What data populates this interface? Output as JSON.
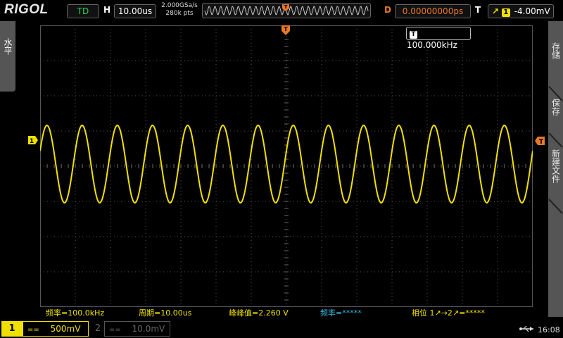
{
  "topbar": {
    "brand": "RIGOL",
    "run_state": "TD",
    "horizontal_label": "H",
    "timebase": "10.00us",
    "sample_rate": "2.000GSa/s",
    "memory_depth": "280k pts",
    "delay_label": "D",
    "delay_value": "0.00000000ps",
    "trigger_label": "T",
    "trigger_channel": "1",
    "trigger_level": "-4.00mV"
  },
  "left_panel": {
    "label": "水平"
  },
  "right_menu": {
    "item_1": "存储",
    "item_2": "保存",
    "item_3": "新建文件"
  },
  "screen": {
    "frequency_counter": "100.000kHz",
    "trigger_marker": "T",
    "ch1_marker": "1"
  },
  "measurements": {
    "frequency": "频率=100.0kHz",
    "period": "周期=10.00us",
    "vpp": "峰峰值=2.260 V",
    "freq_ch2": "频率=*****",
    "phase_a": "相位 1",
    "phase_b": "→2",
    "phase_c": "=*****"
  },
  "bottombar": {
    "ch1_number": "1",
    "ch1_coupling": "==",
    "ch1_scale": "500mV",
    "ch2_number": "2",
    "ch2_coupling": "==",
    "ch2_scale": "10.0mV",
    "clock": "16:08"
  },
  "chart_data": {
    "type": "line",
    "series": [
      {
        "channel": "1",
        "color": "#f0e000",
        "waveform": "sine",
        "frequency_hz": 100000,
        "cycles_on_screen": 14,
        "amplitude_div": 2.2
      }
    ],
    "grid": true,
    "x_divisions": 14,
    "y_divisions": 8
  },
  "colors": {
    "ch1": "#f0e000",
    "ch2": "#666666",
    "delay": "#e8772a",
    "run": "#2bd05a",
    "cyan": "#3ab8e0"
  }
}
